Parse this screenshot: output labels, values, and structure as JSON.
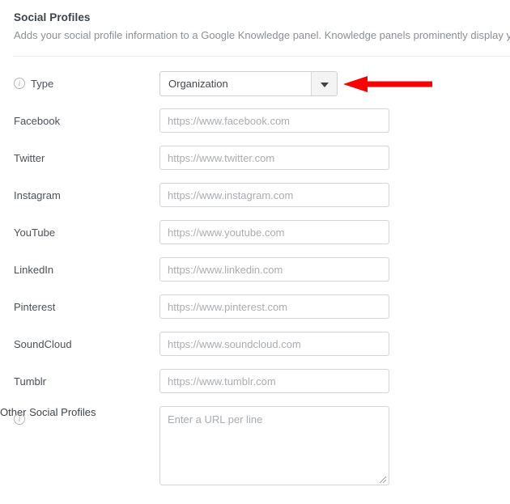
{
  "panel": {
    "title": "Social Profiles",
    "description": "Adds your social profile information to a Google Knowledge panel. Knowledge panels prominently display y"
  },
  "type_field": {
    "icon": "info-icon",
    "label": "Type",
    "selected_value": "Organization",
    "dropdown_icon": "chevron-down-icon"
  },
  "annotation": {
    "arrow_color": "#fe0000",
    "direction": "left",
    "points_at": "type-dropdown"
  },
  "fields": [
    {
      "label": "Facebook",
      "placeholder": "https://www.facebook.com",
      "value": "",
      "name": "facebook"
    },
    {
      "label": "Twitter",
      "placeholder": "https://www.twitter.com",
      "value": "",
      "name": "twitter"
    },
    {
      "label": "Instagram",
      "placeholder": "https://www.instagram.com",
      "value": "",
      "name": "instagram"
    },
    {
      "label": "YouTube",
      "placeholder": "https://www.youtube.com",
      "value": "",
      "name": "youtube"
    },
    {
      "label": "LinkedIn",
      "placeholder": "https://www.linkedin.com",
      "value": "",
      "name": "linkedin"
    },
    {
      "label": "Pinterest",
      "placeholder": "https://www.pinterest.com",
      "value": "",
      "name": "pinterest"
    },
    {
      "label": "SoundCloud",
      "placeholder": "https://www.soundcloud.com",
      "value": "",
      "name": "soundcloud"
    },
    {
      "label": "Tumblr",
      "placeholder": "https://www.tumblr.com",
      "value": "",
      "name": "tumblr"
    }
  ],
  "other_profiles": {
    "icon": "info-icon",
    "label": "Other Social Profiles",
    "placeholder": "Enter a URL per line",
    "value": ""
  },
  "colors": {
    "title": "#3c434a",
    "description": "#8b9096",
    "label": "#4b5159",
    "placeholder": "#a9adb1",
    "border": "#d5d5d5",
    "divider": "#ececec",
    "annotation": "#fe0000"
  },
  "icon_glyphs": {
    "info": "i"
  }
}
